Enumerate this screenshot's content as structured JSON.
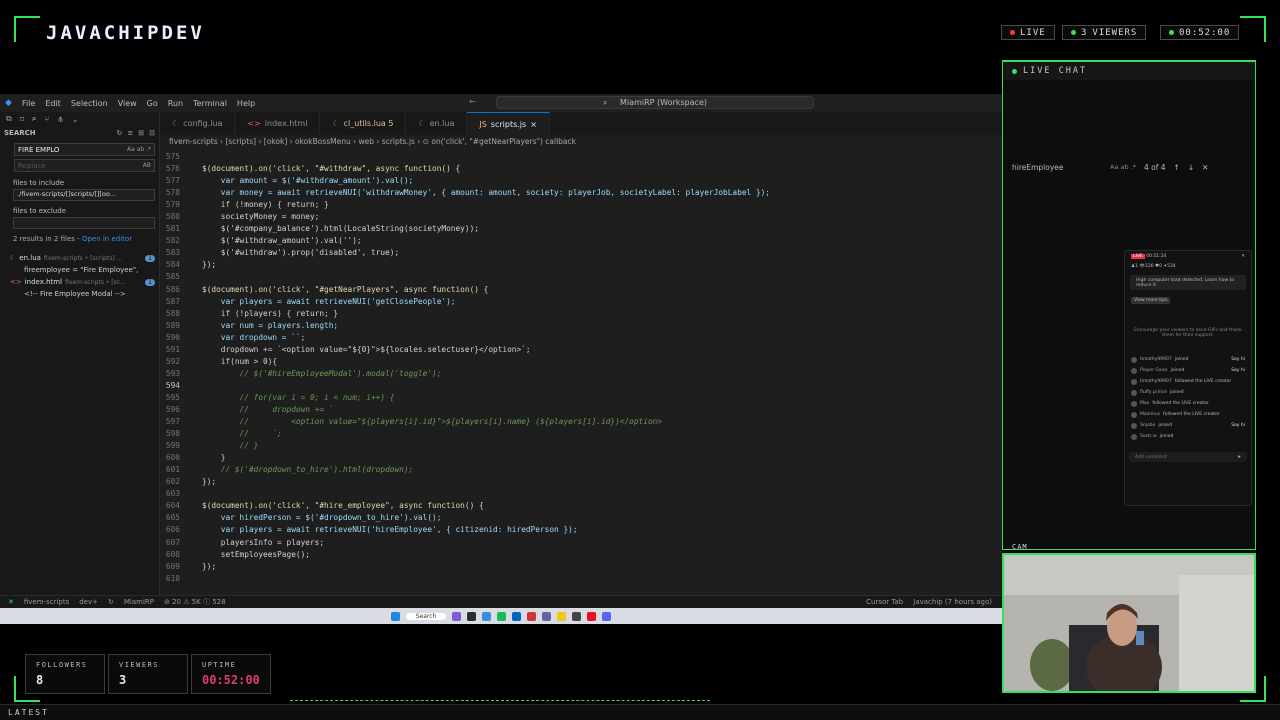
{
  "overlay": {
    "brand": "JAVACHIPDEV",
    "live_label": "LIVE",
    "viewers_count": "3",
    "viewers_label": "VIEWERS",
    "timer": "00:52:00",
    "live_chat_title": "LIVE CHAT",
    "cam_label": "CAM",
    "latest_label": "LATEST",
    "stats": [
      {
        "label": "FOLLOWERS",
        "value": "8"
      },
      {
        "label": "VIEWERS",
        "value": "3"
      },
      {
        "label": "UPTIME",
        "value": "00:52:00"
      }
    ],
    "accent": "#38e05a",
    "live_dot": "#ff3b30"
  },
  "vscode": {
    "menu": [
      "File",
      "Edit",
      "Selection",
      "View",
      "Go",
      "Run",
      "Terminal",
      "Help"
    ],
    "command_center": "MiamiRP (Workspace)",
    "search": {
      "title": "SEARCH",
      "query": "FIRE EMPLO",
      "replace_placeholder": "Replace",
      "include_label": "files to include",
      "include_value": "./fivem-scripts/[]scripts/[][oo...",
      "exclude_label": "files to exclude",
      "summary": "2 results in 2 files -",
      "open_in_editor": "Open in editor",
      "results": [
        {
          "file": "en.lua",
          "path": "fivem-scripts • [scripts] ...",
          "count": "1",
          "match": "fireemployee = \"Fire Employee\","
        },
        {
          "file": "index.html",
          "path": "fivem-scripts • [sc...",
          "count": "1",
          "match": "<!-- Fire Employee Modal -->"
        }
      ]
    },
    "tabs": [
      {
        "label": "config.lua",
        "icon": "lua-icon",
        "active": false
      },
      {
        "label": "index.html",
        "icon": "html-icon",
        "active": false
      },
      {
        "label": "cl_utils.lua 5",
        "icon": "lua-icon",
        "active": false
      },
      {
        "label": "en.lua",
        "icon": "lua-icon",
        "active": false
      },
      {
        "label": "scripts.js",
        "icon": "js-icon",
        "active": true
      }
    ],
    "tab_close": "×",
    "breadcrumb": "fivem-scripts › [scripts] › [okok] › okokBossMenu › web › scripts.js › ⊙ on('click', \"#getNearPlayers\") callback",
    "find_widget": {
      "query": "hireEmployee",
      "count": "4 of 4",
      "options": "Aa ab .*"
    },
    "code": [
      {
        "n": "575",
        "t": ""
      },
      {
        "n": "576",
        "t": "$(document).on('click', \"#withdraw\", async function() {"
      },
      {
        "n": "577",
        "t": "    var amount = $('#withdraw_amount').val();"
      },
      {
        "n": "578",
        "t": "    var money = await retrieveNUI('withdrawMoney', { amount: amount, society: playerJob, societyLabel: playerJobLabel });"
      },
      {
        "n": "579",
        "t": "    if (!money) { return; }"
      },
      {
        "n": "580",
        "t": "    societyMoney = money;"
      },
      {
        "n": "581",
        "t": "    $('#company_balance').html(LocaleString(societyMoney));"
      },
      {
        "n": "582",
        "t": "    $('#withdraw_amount').val('');"
      },
      {
        "n": "583",
        "t": "    $('#withdraw').prop('disabled', true);"
      },
      {
        "n": "584",
        "t": "});"
      },
      {
        "n": "585",
        "t": ""
      },
      {
        "n": "586",
        "t": "$(document).on('click', \"#getNearPlayers\", async function() {"
      },
      {
        "n": "587",
        "t": "    var players = await retrieveNUI('getClosePeople');"
      },
      {
        "n": "588",
        "t": "    if (!players) { return; }"
      },
      {
        "n": "589",
        "t": "    var num = players.length;"
      },
      {
        "n": "590",
        "t": "    var dropdown = ``;"
      },
      {
        "n": "591",
        "t": "    dropdown += `<option value=\"${0}\">${locales.selectuser}</option>`;"
      },
      {
        "n": "592",
        "t": "    if(num > 0){"
      },
      {
        "n": "593",
        "t": "        // $('#hireEmployeeModal').modal('toggle');"
      },
      {
        "n": "594",
        "t": ""
      },
      {
        "n": "595",
        "t": "        // for(var i = 0; i < num; i++) {"
      },
      {
        "n": "596",
        "t": "        //     dropdown += `"
      },
      {
        "n": "597",
        "t": "        //         <option value=\"${players[i].id}\">${players[i].name} (${players[i].id})</option>"
      },
      {
        "n": "598",
        "t": "        //     `;"
      },
      {
        "n": "599",
        "t": "        // }"
      },
      {
        "n": "600",
        "t": "    }"
      },
      {
        "n": "601",
        "t": "    // $('#dropdown_to_hire').html(dropdown);"
      },
      {
        "n": "602",
        "t": "});"
      },
      {
        "n": "603",
        "t": ""
      },
      {
        "n": "604",
        "t": "$(document).on('click', \"#hire_employee\", async function() {"
      },
      {
        "n": "605",
        "t": "    var hiredPerson = $('#dropdown_to_hire').val();"
      },
      {
        "n": "606",
        "t": "    var players = await retrieveNUI('hireEmployee', { citizenid: hiredPerson });"
      },
      {
        "n": "607",
        "t": "    playersInfo = players;"
      },
      {
        "n": "608",
        "t": "    setEmployeesPage();"
      },
      {
        "n": "609",
        "t": "});"
      },
      {
        "n": "610",
        "t": ""
      }
    ],
    "current_line": "594",
    "status": {
      "branch": "fivem-scripts",
      "dev": "dev+",
      "project": "MiamiRP",
      "problems": "⊘ 20 ⚠ 5K ⓘ 528",
      "cursor_tab": "Cursor Tab",
      "author": "Javachip (7 hours ago)"
    },
    "taskbar_search": "Search"
  },
  "tiktok": {
    "timer": "00:51:24",
    "stats": "♟1  👁126  ♥0  ✦534",
    "alert": "High computer load detected. Learn how to reduce it.",
    "view_tips": "View more tips",
    "encourage": "Encourage your viewers to send GIFs and thank them for their support.",
    "events": [
      {
        "user": "timothy99907",
        "text": "joined",
        "action": "Say hi"
      },
      {
        "user": "Player Gaiss",
        "text": "joined",
        "action": "Say hi"
      },
      {
        "user": "timothy99907",
        "text": "followed the LIVE creator",
        "action": ""
      },
      {
        "user": "fluffy prince",
        "text": "joined",
        "action": ""
      },
      {
        "user": "Max",
        "text": "followed the LIVE creator",
        "action": ""
      },
      {
        "user": "Maximus",
        "text": "followed the LIVE creator",
        "action": ""
      },
      {
        "user": "Snjobo",
        "text": "joined",
        "action": "Say hi"
      },
      {
        "user": "Sostr.io",
        "text": "joined",
        "action": ""
      }
    ],
    "add_comment": "Add comment"
  }
}
